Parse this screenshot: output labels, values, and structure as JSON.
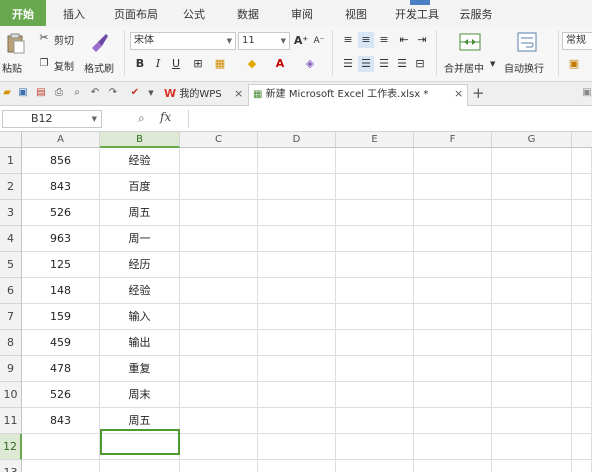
{
  "menu": {
    "tabs": [
      "开始",
      "插入",
      "页面布局",
      "公式",
      "数据",
      "审阅",
      "视图",
      "开发工具",
      "云服务"
    ],
    "active": 0
  },
  "ribbon": {
    "paste_label": "粘贴",
    "cut_label": "剪切",
    "copy_label": "复制",
    "format_painter_label": "格式刷",
    "font_name": "宋体",
    "font_size": "11",
    "bold": "B",
    "italic": "I",
    "underline": "U",
    "grow_font": "A⁺",
    "shrink_font": "A⁻",
    "merge_center_label": "合并居中",
    "wrap_text_label": "自动换行",
    "number_format": "常规"
  },
  "docbar": {
    "wps_tab_label": "我的WPS",
    "file_tab_label": "新建 Microsoft Excel 工作表.xlsx *",
    "close_glyph": "×",
    "add_glyph": "+"
  },
  "formula_bar": {
    "cell_ref": "B12",
    "fx_label": "fx",
    "content": ""
  },
  "sheet": {
    "columns": [
      "A",
      "B",
      "C",
      "D",
      "E",
      "F",
      "G"
    ],
    "selected_column": "B",
    "selected_row": 12,
    "rows": [
      {
        "num": "1",
        "a": "856",
        "b": "经验"
      },
      {
        "num": "2",
        "a": "843",
        "b": "百度"
      },
      {
        "num": "3",
        "a": "526",
        "b": "周五"
      },
      {
        "num": "4",
        "a": "963",
        "b": "周一"
      },
      {
        "num": "5",
        "a": "125",
        "b": "经历"
      },
      {
        "num": "6",
        "a": "148",
        "b": "经验"
      },
      {
        "num": "7",
        "a": "159",
        "b": "输入"
      },
      {
        "num": "8",
        "a": "459",
        "b": "输出"
      },
      {
        "num": "9",
        "a": "478",
        "b": "重复"
      },
      {
        "num": "10",
        "a": "526",
        "b": "周末"
      },
      {
        "num": "11",
        "a": "843",
        "b": "周五"
      },
      {
        "num": "12",
        "a": "",
        "b": ""
      },
      {
        "num": "13",
        "a": "",
        "b": ""
      }
    ]
  },
  "colors": {
    "accent_green": "#6aa84f",
    "active_cell_border": "#4e9a2e"
  }
}
